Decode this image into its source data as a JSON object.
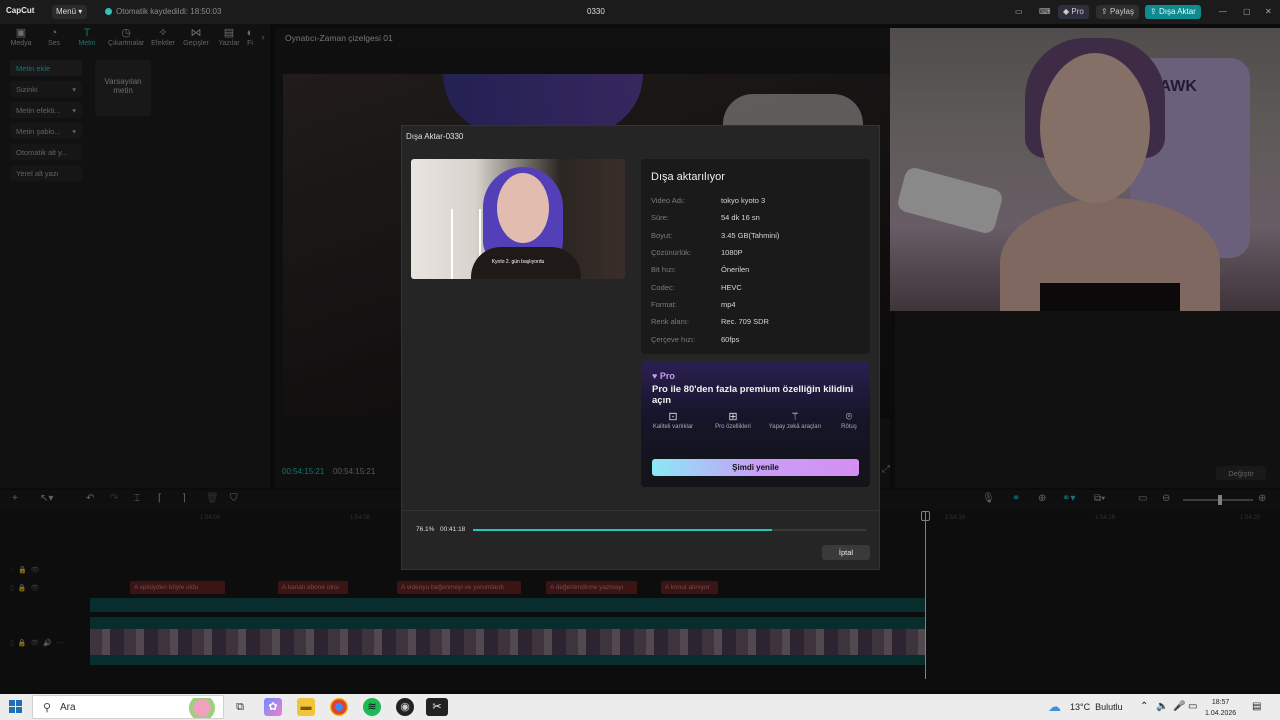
{
  "app": {
    "logo": "CapCut",
    "menu_label": "Menü",
    "autosave_status": "Otomatik kaydedildi: 18:50:03",
    "project_title": "0330",
    "pro_label": "Pro",
    "share_label": "Paylaş",
    "export_label": "Dışa Aktar"
  },
  "toolbar": {
    "tabs": [
      {
        "label": "Medya",
        "icon": "media-icon"
      },
      {
        "label": "Ses",
        "icon": "audio-icon"
      },
      {
        "label": "Metin",
        "icon": "text-icon",
        "active": true
      },
      {
        "label": "Çıkartmalar",
        "icon": "sticker-icon"
      },
      {
        "label": "Efektler",
        "icon": "effects-icon"
      },
      {
        "label": "Geçişler",
        "icon": "transition-icon"
      },
      {
        "label": "Yazılar",
        "icon": "captions-icon"
      },
      {
        "label": "Fi",
        "icon": "filter-icon"
      }
    ]
  },
  "left_nav": {
    "items": [
      {
        "label": "Metin ekle",
        "active": true
      },
      {
        "label": "Sizinki"
      },
      {
        "label": "Metin efekti..."
      },
      {
        "label": "Metin şablo..."
      },
      {
        "label": "Otomatik alt y..."
      },
      {
        "label": "Yerel alt yazı"
      }
    ],
    "default_card_label": "Varsayılan metin"
  },
  "player": {
    "title": "Oynatıcı-Zaman çizelgesi 01",
    "current_time": "00:54:15:21",
    "total_time": "00:54:15:21"
  },
  "right_panel": {
    "change_label": "Değiştir"
  },
  "timeline": {
    "ruler_ticks": [
      "1:54:06",
      "1:54:08",
      "1:54:16",
      "1:54:18",
      "1:54:20"
    ],
    "text_clips": [
      "spisiyden böyle oldu",
      "kanalı abone olrsı",
      "videoyu beğenmeyi ve yorumlardı",
      "değerlendirme yazmayı",
      "konut alınıyor"
    ]
  },
  "export_dialog": {
    "title": "Dışa Aktar-0330",
    "preview_subtitle": "Kyoto 2. gün başlıyordu",
    "heading": "Dışa aktarılıyor",
    "fields": [
      {
        "key": "Video Adı:",
        "value": "tokyo kyoto 3"
      },
      {
        "key": "Süre:",
        "value": "54 dk 16 sn"
      },
      {
        "key": "Boyut:",
        "value": "3.45 GB(Tahmini)"
      },
      {
        "key": "Çözünürlük:",
        "value": "1080P"
      },
      {
        "key": "Bit hızı:",
        "value": "Önerilen"
      },
      {
        "key": "Codec:",
        "value": "HEVC"
      },
      {
        "key": "Format:",
        "value": "mp4"
      },
      {
        "key": "Renk alanı:",
        "value": "Rec. 709 SDR"
      },
      {
        "key": "Çerçeve hızı:",
        "value": "60fps"
      }
    ],
    "pro": {
      "badge": "Pro",
      "message": "Pro ile 80'den fazla premium özelliğin kilidini açın",
      "features": [
        {
          "label": "Kaliteli varlıklar",
          "icon": "image-sparkle-icon"
        },
        {
          "label": "Pro özellikleri",
          "icon": "grid-sparkle-icon"
        },
        {
          "label": "Yapay zekâ araçları",
          "icon": "magic-wand-icon"
        },
        {
          "label": "Rötuş",
          "icon": "portrait-icon"
        }
      ],
      "upgrade_label": "Şimdi yenile"
    },
    "progress_percent_label": "76.1%",
    "progress_value": 0.761,
    "elapsed_time": "00:41:18",
    "cancel_label": "İptal"
  },
  "webcam": {
    "chair_text": "HAWK"
  },
  "taskbar": {
    "search_placeholder": "Ara",
    "weather_temp": "13°C",
    "weather_desc": "Bulutlu",
    "time": "18:57",
    "date": "1.04.2026"
  },
  "colors": {
    "accent": "#28c8c8",
    "progress": "#26c6b8",
    "export_button": "#0f8a8f",
    "text_clip": "#8c2a2a",
    "video_track": "#0f4e4c"
  }
}
